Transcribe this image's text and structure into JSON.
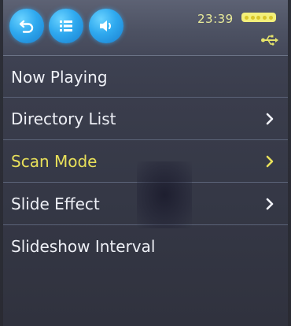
{
  "statusbar": {
    "time": "23:39",
    "icons": {
      "back": "back-icon",
      "list": "list-icon",
      "volume": "volume-icon",
      "battery": "battery-icon",
      "usb": "usb-icon"
    },
    "colors": {
      "accent_blue": "#2fa9ef",
      "clock": "#e9eb9a",
      "battery": "#f3ef7a"
    }
  },
  "menu": {
    "items": [
      {
        "label": "Now Playing",
        "has_arrow": false,
        "selected": false
      },
      {
        "label": "Directory List",
        "has_arrow": true,
        "selected": false
      },
      {
        "label": "Scan Mode",
        "has_arrow": true,
        "selected": true
      },
      {
        "label": "Slide Effect",
        "has_arrow": true,
        "selected": false
      },
      {
        "label": "Slideshow Interval",
        "has_arrow": false,
        "selected": false
      }
    ],
    "colors": {
      "text": "#eef0f6",
      "selected_text": "#e8e05a"
    }
  }
}
